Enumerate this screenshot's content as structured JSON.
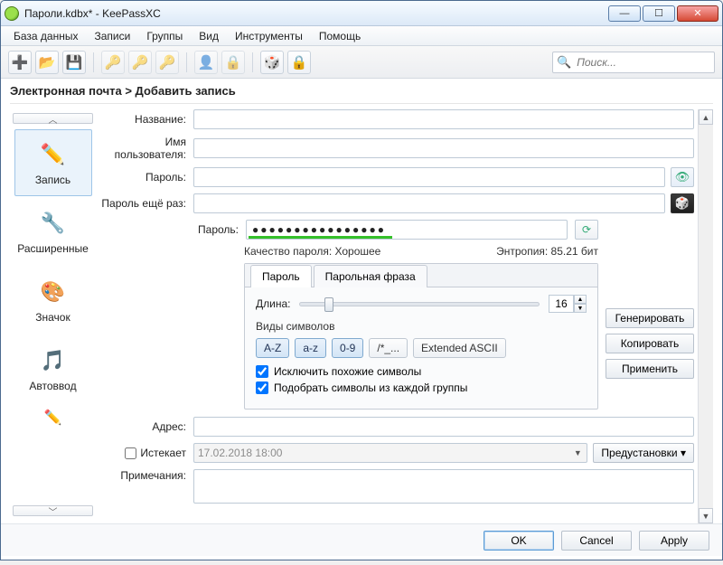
{
  "window": {
    "title": "Пароли.kdbx* - KeePassXC"
  },
  "menu": {
    "db": "База данных",
    "entries": "Записи",
    "groups": "Группы",
    "view": "Вид",
    "tools": "Инструменты",
    "help": "Помощь"
  },
  "search": {
    "placeholder": "Поиск..."
  },
  "breadcrumb": "Электронная почта > Добавить запись",
  "sidebar": {
    "items": [
      {
        "label": "Запись"
      },
      {
        "label": "Расширенные"
      },
      {
        "label": "Значок"
      },
      {
        "label": "Автоввод"
      }
    ]
  },
  "form": {
    "title_lbl": "Название:",
    "user_lbl": "Имя пользователя:",
    "pass_lbl": "Пароль:",
    "pass2_lbl": "Пароль ещё раз:",
    "url_lbl": "Адрес:",
    "expires_lbl": "Истекает",
    "notes_lbl": "Примечания:",
    "expires_value": "17.02.2018 18:00",
    "presets": "Предустановки ▾"
  },
  "gen": {
    "pass_lbl": "Пароль:",
    "dots": "●●●●●●●●●●●●●●●●",
    "quality_lbl": "Качество пароля: Хорошее",
    "entropy_lbl": "Энтропия: 85.21 бит",
    "tab_pw": "Пароль",
    "tab_phrase": "Парольная фраза",
    "length_lbl": "Длина:",
    "length_val": "16",
    "charset_title": "Виды символов",
    "t_upper": "A-Z",
    "t_lower": "a-z",
    "t_digit": "0-9",
    "t_special": "/*_...",
    "t_ext": "Extended ASCII",
    "chk1": "Исключить похожие символы",
    "chk2": "Подобрать символы из каждой группы",
    "btn_generate": "Генерировать",
    "btn_copy": "Копировать",
    "btn_apply": "Применить"
  },
  "footer": {
    "ok": "OK",
    "cancel": "Cancel",
    "apply": "Apply"
  }
}
